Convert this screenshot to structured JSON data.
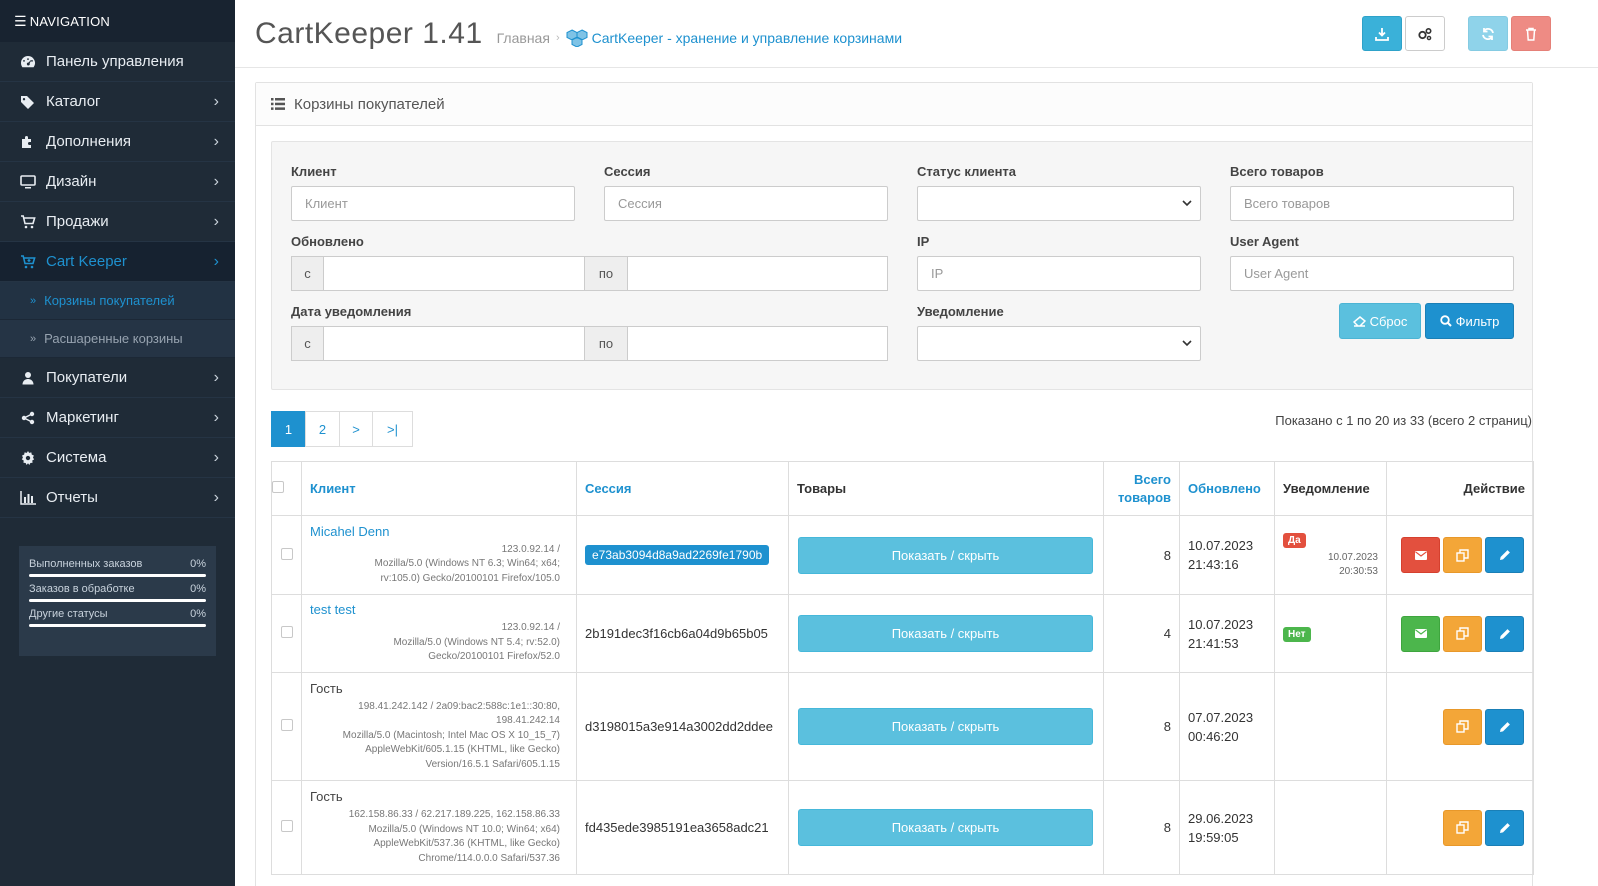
{
  "nav": {
    "header": "NAVIGATION",
    "items": [
      {
        "label": "Панель управления",
        "icon": "dashboard-icon",
        "chevron": false
      },
      {
        "label": "Каталог",
        "icon": "tag-icon",
        "chevron": true
      },
      {
        "label": "Дополнения",
        "icon": "puzzle-icon",
        "chevron": true
      },
      {
        "label": "Дизайн",
        "icon": "monitor-icon",
        "chevron": true
      },
      {
        "label": "Продажи",
        "icon": "cart-icon",
        "chevron": true
      },
      {
        "label": "Cart Keeper",
        "icon": "cart-plus-icon",
        "chevron": true,
        "active": true
      }
    ],
    "subitems": [
      {
        "label": "Корзины покупателей",
        "active": true
      },
      {
        "label": "Расшаренные корзины",
        "active": false
      }
    ],
    "items2": [
      {
        "label": "Покупатели",
        "icon": "user-icon"
      },
      {
        "label": "Маркетинг",
        "icon": "share-icon"
      },
      {
        "label": "Система",
        "icon": "gear-icon"
      },
      {
        "label": "Отчеты",
        "icon": "bar-chart-icon"
      }
    ]
  },
  "stats": [
    {
      "label": "Выполненных заказов",
      "value": "0%"
    },
    {
      "label": "Заказов в обработке",
      "value": "0%"
    },
    {
      "label": "Другие статусы",
      "value": "0%"
    }
  ],
  "header": {
    "title": "CartKeeper 1.41",
    "breadcrumb_home": "Главная",
    "breadcrumb_current": "CartKeeper - хранение и управление корзинами"
  },
  "panel": {
    "title": "Корзины покупателей"
  },
  "filter": {
    "client_label": "Клиент",
    "client_placeholder": "Клиент",
    "session_label": "Сессия",
    "session_placeholder": "Сессия",
    "status_label": "Статус клиента",
    "total_label": "Всего товаров",
    "total_placeholder": "Всего товаров",
    "updated_label": "Обновлено",
    "from": "с",
    "to": "по",
    "ip_label": "IP",
    "ip_placeholder": "IP",
    "ua_label": "User Agent",
    "ua_placeholder": "User Agent",
    "notify_date_label": "Дата уведомления",
    "notify_label": "Уведомление",
    "reset": "Сброс",
    "filter": "Фильтр"
  },
  "pagination": {
    "pages": [
      "1",
      "2",
      ">",
      ">|"
    ],
    "info": "Показано с 1 по 20 из 33 (всего 2 страниц)"
  },
  "table": {
    "headers": {
      "client": "Клиент",
      "session": "Сессия",
      "goods": "Товары",
      "total_line1": "Всего",
      "total_line2": "товаров",
      "updated": "Обновлено",
      "notice": "Уведомление",
      "action": "Действие"
    },
    "toggle_label": "Показать / скрыть",
    "rows": [
      {
        "client": "Micahel Denn",
        "client_is_link": true,
        "ua": [
          "123.0.92.14 /",
          "Mozilla/5.0 (Windows NT 6.3; Win64; x64;",
          "rv:105.0) Gecko/20100101 Firefox/105.0"
        ],
        "session": "e73ab3094d8a9ad2269fe1790b",
        "session_badge": true,
        "total": "8",
        "date": "10.07.2023",
        "time": "21:43:16",
        "notice": "Да",
        "notice_date": "10.07.2023",
        "notice_time": "20:30:53",
        "mail": "red"
      },
      {
        "client": "test test",
        "client_is_link": true,
        "ua": [
          "123.0.92.14 /",
          "Mozilla/5.0 (Windows NT 5.4; rv:52.0)",
          "Gecko/20100101 Firefox/52.0"
        ],
        "session": "2b191dec3f16cb6a04d9b65b05",
        "session_badge": false,
        "total": "4",
        "date": "10.07.2023",
        "time": "21:41:53",
        "notice": "Нет",
        "mail": "green"
      },
      {
        "client": "Гость",
        "client_is_link": false,
        "ua": [
          "198.41.242.142 / 2a09:bac2:588c:1e1::30:80,",
          "198.41.242.14",
          "Mozilla/5.0 (Macintosh; Intel Mac OS X 10_15_7)",
          "AppleWebKit/605.1.15 (KHTML, like Gecko)",
          "Version/16.5.1 Safari/605.1.15"
        ],
        "session": "d3198015a3e914a3002dd2ddee",
        "session_badge": false,
        "total": "8",
        "date": "07.07.2023",
        "time": "00:46:20",
        "notice": "",
        "mail": ""
      },
      {
        "client": "Гость",
        "client_is_link": false,
        "ua": [
          "162.158.86.33 / 62.217.189.225, 162.158.86.33",
          "Mozilla/5.0 (Windows NT 10.0; Win64; x64)",
          "AppleWebKit/537.36 (KHTML, like Gecko)",
          "Chrome/114.0.0.0 Safari/537.36"
        ],
        "session": "fd435ede3985191ea3658adc21",
        "session_badge": false,
        "total": "8",
        "date": "29.06.2023",
        "time": "19:59:05",
        "notice": "",
        "mail": ""
      }
    ]
  }
}
